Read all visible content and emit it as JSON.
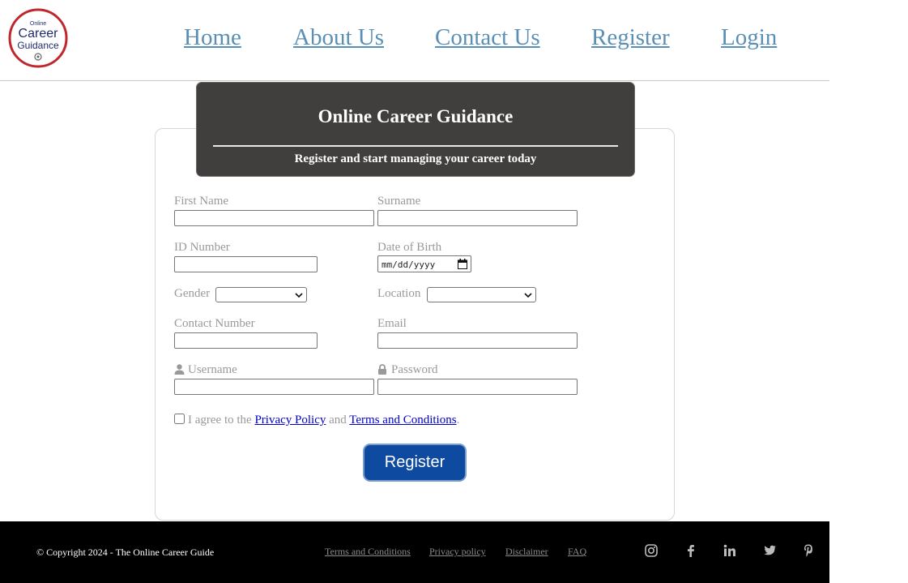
{
  "logo": {
    "line1": "Online",
    "line2": "Career",
    "line3": "Guidance",
    "ring_color": "#c0272d",
    "text_color": "#1f2a6b"
  },
  "nav": {
    "home": "Home",
    "about": "About Us",
    "contact": "Contact Us",
    "register": "Register",
    "login": "Login",
    "link_color": "#5a8fb5"
  },
  "banner": {
    "title": "Online Career Guidance",
    "subtitle": "Register and start managing your career today",
    "bg_color": "#413f3d"
  },
  "form": {
    "first_name_label": "First Name",
    "surname_label": "Surname",
    "id_number_label": "ID Number",
    "dob_label": "Date of Birth",
    "dob_placeholder": "mm/dd/yyyy",
    "gender_label": "Gender",
    "gender_value": "",
    "location_label": "Location",
    "location_value": "",
    "contact_label": "Contact Number",
    "email_label": "Email",
    "username_label": "Username",
    "password_label": "Password",
    "agree_prefix": "I agree to the",
    "privacy_link": "Privacy Policy",
    "agree_and": "and",
    "terms_link": "Terms and Conditions",
    "agree_suffix": ".",
    "submit_label": "Register",
    "button_color": "#0d4aa0"
  },
  "footer": {
    "copyright": "© Copyright 2024 - The Online Career Guide",
    "links": [
      "Terms and Conditions",
      "Privacy policy",
      "Disclaimer",
      "FAQ"
    ],
    "social_icons": [
      "instagram-icon",
      "facebook-icon",
      "linkedin-icon",
      "twitter-icon",
      "pinterest-icon"
    ]
  }
}
